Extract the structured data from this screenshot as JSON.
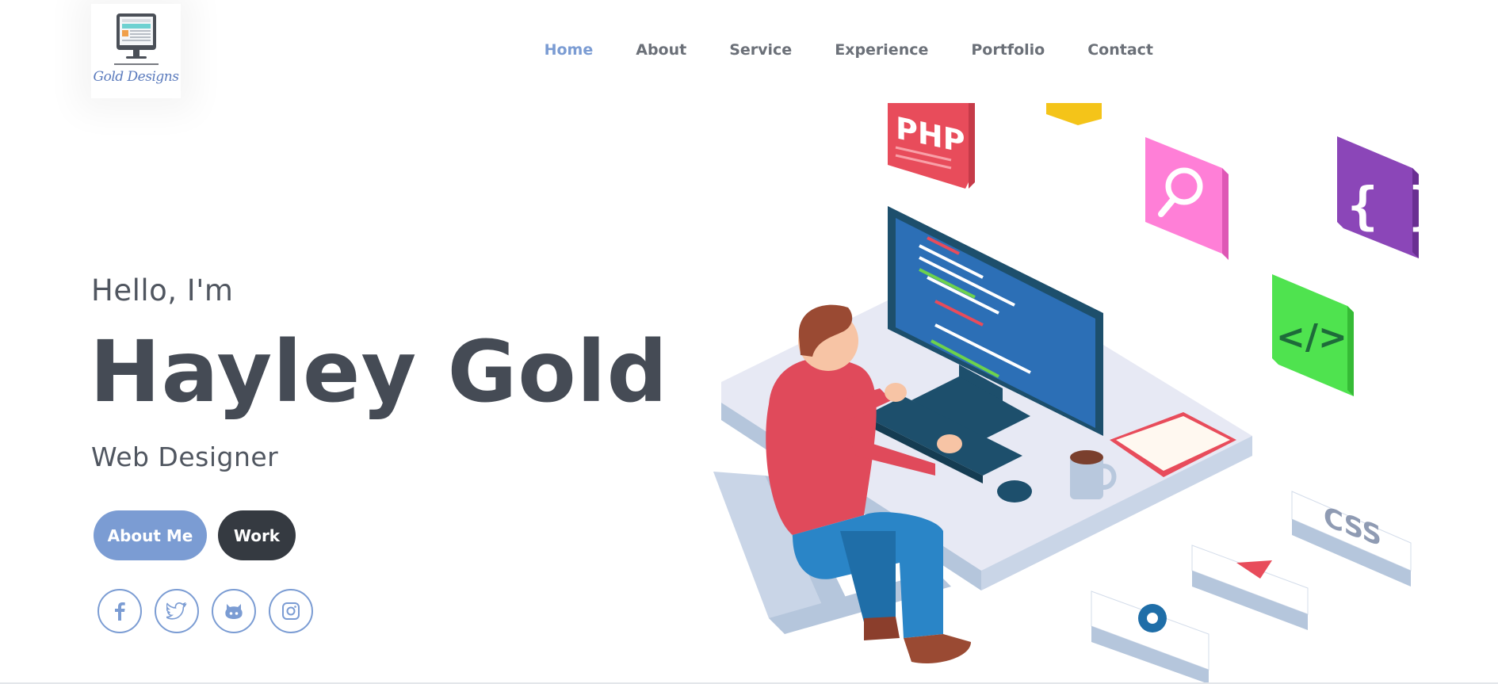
{
  "logo": {
    "text": "Gold Designs"
  },
  "nav": {
    "items": [
      {
        "label": "Home",
        "active": true
      },
      {
        "label": "About",
        "active": false
      },
      {
        "label": "Service",
        "active": false
      },
      {
        "label": "Experience",
        "active": false
      },
      {
        "label": "Portfolio",
        "active": false
      },
      {
        "label": "Contact",
        "active": false
      }
    ]
  },
  "hero": {
    "greeting": "Hello, I'm",
    "name": "Hayley Gold",
    "role": "Web Designer",
    "buttons": {
      "about": "About Me",
      "work": "Work"
    },
    "social_icons": [
      "facebook-icon",
      "twitter-icon",
      "github-icon",
      "instagram-icon"
    ]
  },
  "illustration": {
    "tiles": {
      "php": "PHP",
      "css": "CSS",
      "braces": "{ }",
      "code": "</>"
    }
  },
  "colors": {
    "accent": "#7b9cd3",
    "dark": "#353a41",
    "text": "#454b55"
  }
}
